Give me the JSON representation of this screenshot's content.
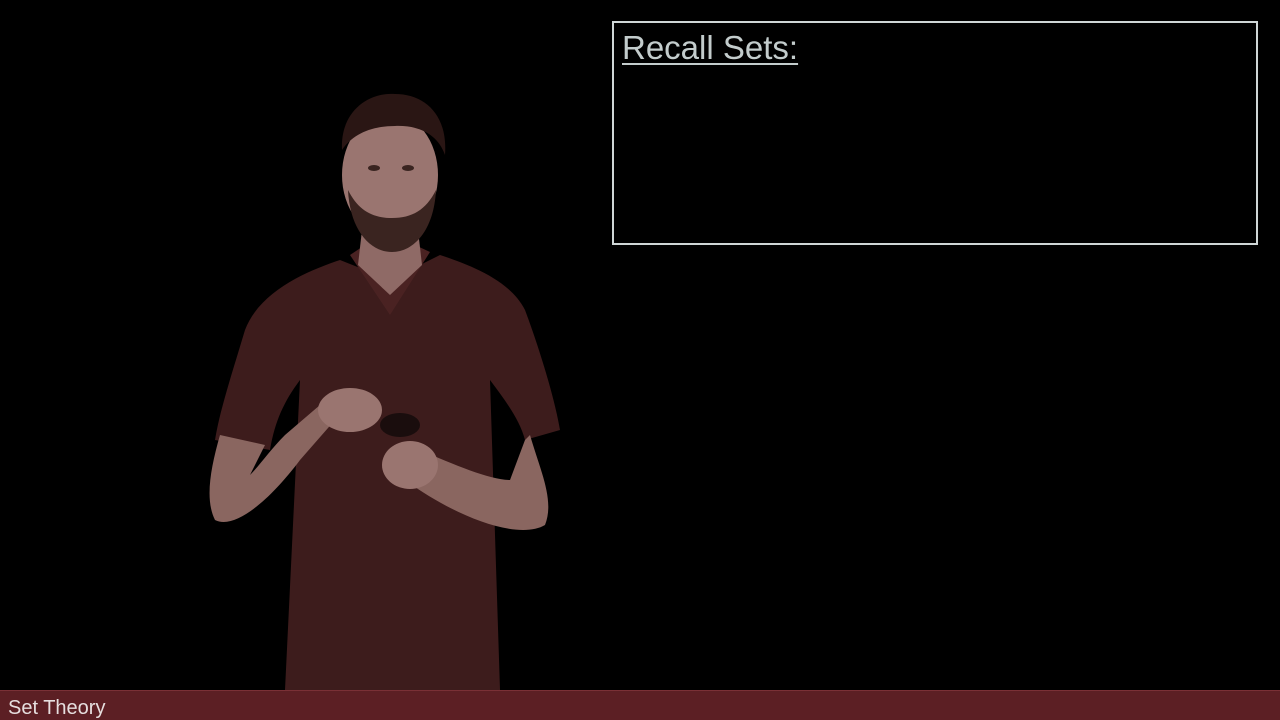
{
  "slide": {
    "title": "Recall Sets:"
  },
  "footer": {
    "label": "Set Theory"
  },
  "colors": {
    "background": "#000000",
    "footer_bar": "#5c1f24",
    "box_border": "#cfd6d6",
    "title_text": "#c3cccc"
  }
}
